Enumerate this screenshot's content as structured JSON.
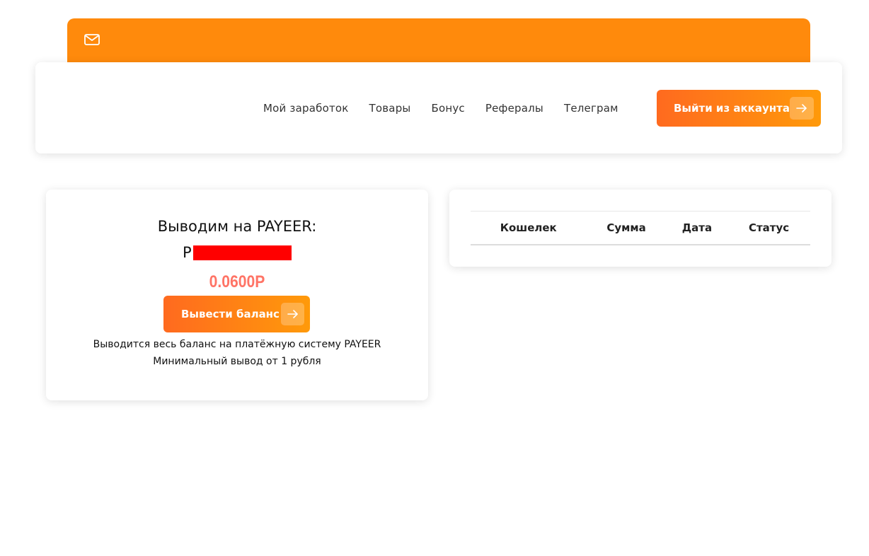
{
  "header": {
    "mail_icon": "envelope-icon",
    "accent_color": "#ff8a0c"
  },
  "nav": {
    "items": [
      {
        "label": "Мой заработок"
      },
      {
        "label": "Товары"
      },
      {
        "label": "Бонус"
      },
      {
        "label": "Рефералы"
      },
      {
        "label": "Телеграм"
      }
    ],
    "logout_label": "Выйти из аккаунта"
  },
  "withdraw": {
    "title": "Выводим на PAYEER:",
    "wallet_prefix": "P",
    "balance": "0.0600Р",
    "button_label": "Вывести баланс",
    "note_line1": "Выводится весь баланс на платёжную систему PAYEER",
    "note_line2": "Минимальный вывод от 1 рубля",
    "balance_color": "#ff7466"
  },
  "history": {
    "columns": [
      "Кошелек",
      "Сумма",
      "Дата",
      "Статус"
    ],
    "rows": []
  }
}
